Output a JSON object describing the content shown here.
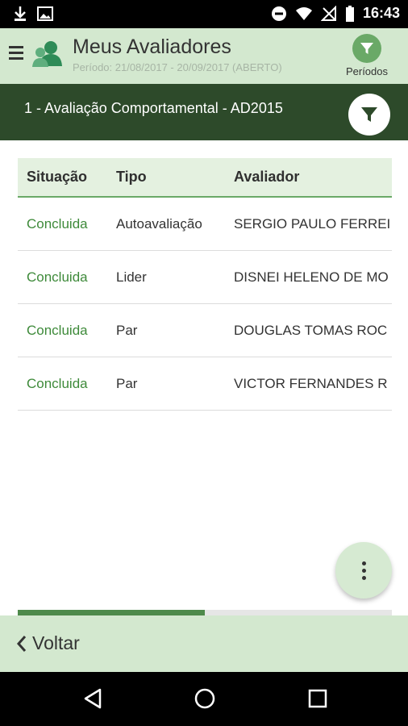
{
  "status_bar": {
    "time": "16:43",
    "icons": [
      "download-icon",
      "image-icon",
      "do-not-disturb-icon",
      "wifi-icon",
      "no-signal-icon",
      "battery-icon"
    ]
  },
  "header": {
    "title": "Meus Avaliadores",
    "subtitle": "Período: 21/08/2017 - 20/09/2017 (ABERTO)",
    "periods_label": "Períodos"
  },
  "section": {
    "title": "1 - Avaliação Comportamental - AD2015"
  },
  "table": {
    "columns": [
      "Situação",
      "Tipo",
      "Avaliador"
    ],
    "rows": [
      [
        "Concluida",
        "Autoavaliação",
        "SERGIO PAULO FERREI"
      ],
      [
        "Concluida",
        "Lider",
        "DISNEI HELENO DE MO"
      ],
      [
        "Concluida",
        "Par",
        "DOUGLAS TOMAS ROC"
      ],
      [
        "Concluida",
        "Par",
        "VICTOR FERNANDES R"
      ]
    ]
  },
  "scroll_progress": 0.5,
  "footer": {
    "back_label": "Voltar"
  },
  "colors": {
    "header_bg": "#d3e8cf",
    "section_bg": "#2d4a2a",
    "accent": "#6aa967",
    "status_text": "#3e8a3a"
  }
}
